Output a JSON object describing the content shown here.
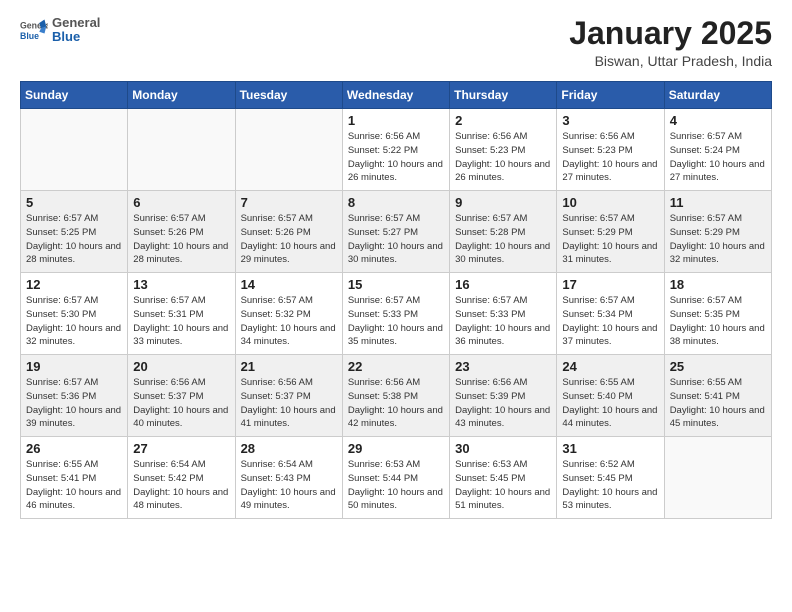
{
  "header": {
    "logo_general": "General",
    "logo_blue": "Blue",
    "month_title": "January 2025",
    "location": "Biswan, Uttar Pradesh, India"
  },
  "weekdays": [
    "Sunday",
    "Monday",
    "Tuesday",
    "Wednesday",
    "Thursday",
    "Friday",
    "Saturday"
  ],
  "weeks": [
    [
      {
        "day": "",
        "sunrise": "",
        "sunset": "",
        "daylight": ""
      },
      {
        "day": "",
        "sunrise": "",
        "sunset": "",
        "daylight": ""
      },
      {
        "day": "",
        "sunrise": "",
        "sunset": "",
        "daylight": ""
      },
      {
        "day": "1",
        "sunrise": "Sunrise: 6:56 AM",
        "sunset": "Sunset: 5:22 PM",
        "daylight": "Daylight: 10 hours and 26 minutes."
      },
      {
        "day": "2",
        "sunrise": "Sunrise: 6:56 AM",
        "sunset": "Sunset: 5:23 PM",
        "daylight": "Daylight: 10 hours and 26 minutes."
      },
      {
        "day": "3",
        "sunrise": "Sunrise: 6:56 AM",
        "sunset": "Sunset: 5:23 PM",
        "daylight": "Daylight: 10 hours and 27 minutes."
      },
      {
        "day": "4",
        "sunrise": "Sunrise: 6:57 AM",
        "sunset": "Sunset: 5:24 PM",
        "daylight": "Daylight: 10 hours and 27 minutes."
      }
    ],
    [
      {
        "day": "5",
        "sunrise": "Sunrise: 6:57 AM",
        "sunset": "Sunset: 5:25 PM",
        "daylight": "Daylight: 10 hours and 28 minutes."
      },
      {
        "day": "6",
        "sunrise": "Sunrise: 6:57 AM",
        "sunset": "Sunset: 5:26 PM",
        "daylight": "Daylight: 10 hours and 28 minutes."
      },
      {
        "day": "7",
        "sunrise": "Sunrise: 6:57 AM",
        "sunset": "Sunset: 5:26 PM",
        "daylight": "Daylight: 10 hours and 29 minutes."
      },
      {
        "day": "8",
        "sunrise": "Sunrise: 6:57 AM",
        "sunset": "Sunset: 5:27 PM",
        "daylight": "Daylight: 10 hours and 30 minutes."
      },
      {
        "day": "9",
        "sunrise": "Sunrise: 6:57 AM",
        "sunset": "Sunset: 5:28 PM",
        "daylight": "Daylight: 10 hours and 30 minutes."
      },
      {
        "day": "10",
        "sunrise": "Sunrise: 6:57 AM",
        "sunset": "Sunset: 5:29 PM",
        "daylight": "Daylight: 10 hours and 31 minutes."
      },
      {
        "day": "11",
        "sunrise": "Sunrise: 6:57 AM",
        "sunset": "Sunset: 5:29 PM",
        "daylight": "Daylight: 10 hours and 32 minutes."
      }
    ],
    [
      {
        "day": "12",
        "sunrise": "Sunrise: 6:57 AM",
        "sunset": "Sunset: 5:30 PM",
        "daylight": "Daylight: 10 hours and 32 minutes."
      },
      {
        "day": "13",
        "sunrise": "Sunrise: 6:57 AM",
        "sunset": "Sunset: 5:31 PM",
        "daylight": "Daylight: 10 hours and 33 minutes."
      },
      {
        "day": "14",
        "sunrise": "Sunrise: 6:57 AM",
        "sunset": "Sunset: 5:32 PM",
        "daylight": "Daylight: 10 hours and 34 minutes."
      },
      {
        "day": "15",
        "sunrise": "Sunrise: 6:57 AM",
        "sunset": "Sunset: 5:33 PM",
        "daylight": "Daylight: 10 hours and 35 minutes."
      },
      {
        "day": "16",
        "sunrise": "Sunrise: 6:57 AM",
        "sunset": "Sunset: 5:33 PM",
        "daylight": "Daylight: 10 hours and 36 minutes."
      },
      {
        "day": "17",
        "sunrise": "Sunrise: 6:57 AM",
        "sunset": "Sunset: 5:34 PM",
        "daylight": "Daylight: 10 hours and 37 minutes."
      },
      {
        "day": "18",
        "sunrise": "Sunrise: 6:57 AM",
        "sunset": "Sunset: 5:35 PM",
        "daylight": "Daylight: 10 hours and 38 minutes."
      }
    ],
    [
      {
        "day": "19",
        "sunrise": "Sunrise: 6:57 AM",
        "sunset": "Sunset: 5:36 PM",
        "daylight": "Daylight: 10 hours and 39 minutes."
      },
      {
        "day": "20",
        "sunrise": "Sunrise: 6:56 AM",
        "sunset": "Sunset: 5:37 PM",
        "daylight": "Daylight: 10 hours and 40 minutes."
      },
      {
        "day": "21",
        "sunrise": "Sunrise: 6:56 AM",
        "sunset": "Sunset: 5:37 PM",
        "daylight": "Daylight: 10 hours and 41 minutes."
      },
      {
        "day": "22",
        "sunrise": "Sunrise: 6:56 AM",
        "sunset": "Sunset: 5:38 PM",
        "daylight": "Daylight: 10 hours and 42 minutes."
      },
      {
        "day": "23",
        "sunrise": "Sunrise: 6:56 AM",
        "sunset": "Sunset: 5:39 PM",
        "daylight": "Daylight: 10 hours and 43 minutes."
      },
      {
        "day": "24",
        "sunrise": "Sunrise: 6:55 AM",
        "sunset": "Sunset: 5:40 PM",
        "daylight": "Daylight: 10 hours and 44 minutes."
      },
      {
        "day": "25",
        "sunrise": "Sunrise: 6:55 AM",
        "sunset": "Sunset: 5:41 PM",
        "daylight": "Daylight: 10 hours and 45 minutes."
      }
    ],
    [
      {
        "day": "26",
        "sunrise": "Sunrise: 6:55 AM",
        "sunset": "Sunset: 5:41 PM",
        "daylight": "Daylight: 10 hours and 46 minutes."
      },
      {
        "day": "27",
        "sunrise": "Sunrise: 6:54 AM",
        "sunset": "Sunset: 5:42 PM",
        "daylight": "Daylight: 10 hours and 48 minutes."
      },
      {
        "day": "28",
        "sunrise": "Sunrise: 6:54 AM",
        "sunset": "Sunset: 5:43 PM",
        "daylight": "Daylight: 10 hours and 49 minutes."
      },
      {
        "day": "29",
        "sunrise": "Sunrise: 6:53 AM",
        "sunset": "Sunset: 5:44 PM",
        "daylight": "Daylight: 10 hours and 50 minutes."
      },
      {
        "day": "30",
        "sunrise": "Sunrise: 6:53 AM",
        "sunset": "Sunset: 5:45 PM",
        "daylight": "Daylight: 10 hours and 51 minutes."
      },
      {
        "day": "31",
        "sunrise": "Sunrise: 6:52 AM",
        "sunset": "Sunset: 5:45 PM",
        "daylight": "Daylight: 10 hours and 53 minutes."
      },
      {
        "day": "",
        "sunrise": "",
        "sunset": "",
        "daylight": ""
      }
    ]
  ]
}
